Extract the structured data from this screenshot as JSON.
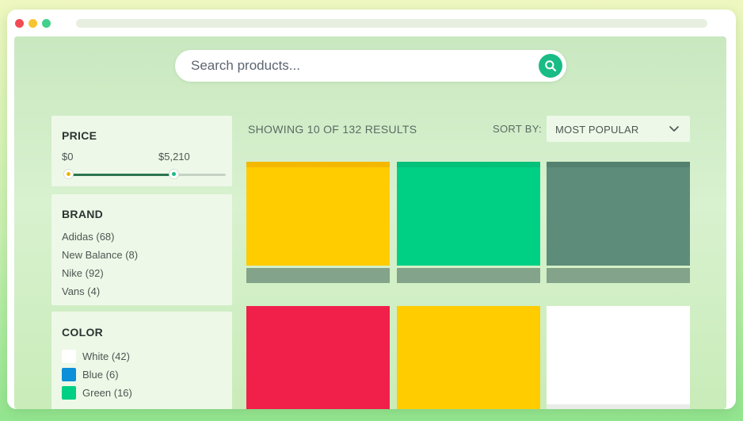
{
  "search": {
    "placeholder": "Search products..."
  },
  "filters": {
    "price": {
      "title": "PRICE",
      "min_label": "$0",
      "max_label": "$5,210",
      "selected_fraction": 0.67
    },
    "brand": {
      "title": "BRAND",
      "items": [
        "Adidas (68)",
        "New Balance (8)",
        "Nike (92)",
        "Vans (4)"
      ]
    },
    "color": {
      "title": "COLOR",
      "items": [
        {
          "label": "White (42)",
          "swatch": "#ffffff"
        },
        {
          "label": "Blue (6)",
          "swatch": "#0a8fd8"
        },
        {
          "label": "Green (16)",
          "swatch": "#00d084"
        }
      ]
    }
  },
  "results": {
    "summary": "SHOWING 10 OF 132 RESULTS"
  },
  "sort": {
    "label": "SORT BY:",
    "value": "MOST POPULAR"
  },
  "products": [
    {
      "color": "#ffcc00",
      "band": "#f5b800"
    },
    {
      "color": "#00d084",
      "band": "#00c07a"
    },
    {
      "color": "#5e8c7a",
      "band": "#54806f"
    },
    {
      "color": "#f0204a",
      "band": "#e8173f"
    },
    {
      "color": "#ffcc00",
      "band": "#f5b800"
    },
    {
      "color": "#ffffff",
      "band": "#ffffff"
    }
  ],
  "colors": {
    "accent": "#1abc85",
    "card_bar": "#83a38a"
  }
}
